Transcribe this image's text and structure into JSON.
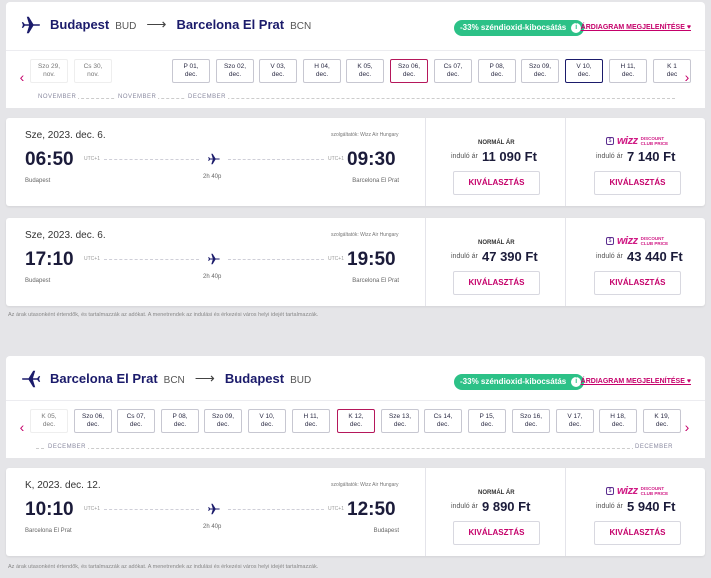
{
  "outbound": {
    "from_city": "Budapest",
    "from_code": "BUD",
    "to_city": "Barcelona El Prat",
    "to_code": "BCN",
    "arrow": "⟶",
    "co2": "-33% széndioxid-kibocsátás",
    "co2_info": "i",
    "price_chart": "ÁRDIAGRAM MEGJELENÍTÉSE ♥",
    "dates": [
      {
        "l1": "Szo 29,",
        "l2": "nov."
      },
      {
        "l1": "Cs 30,",
        "l2": "nov."
      },
      {
        "l1": "P 01,",
        "l2": "dec."
      },
      {
        "l1": "Szo 02,",
        "l2": "dec."
      },
      {
        "l1": "V 03,",
        "l2": "dec."
      },
      {
        "l1": "H 04,",
        "l2": "dec."
      },
      {
        "l1": "K 05,",
        "l2": "dec."
      },
      {
        "l1": "Szo 06,",
        "l2": "dec."
      },
      {
        "l1": "Cs 07,",
        "l2": "dec."
      },
      {
        "l1": "P 08,",
        "l2": "dec."
      },
      {
        "l1": "Szo 09,",
        "l2": "dec."
      },
      {
        "l1": "V 10,",
        "l2": "dec."
      },
      {
        "l1": "H 11,",
        "l2": "dec."
      },
      {
        "l1": "K 1",
        "l2": "dec"
      }
    ],
    "months": [
      "NOVEMBER",
      "NOVEMBER",
      "DECEMBER"
    ],
    "flights": [
      {
        "date": "Sze, 2023. dec. 6.",
        "operated": "szolgáltatók: Wizz Air Hungary",
        "dep": "06:50",
        "arr": "09:30",
        "utc_dep": "UTC+1",
        "utc_arr": "UTC+1",
        "duration": "2h 40p",
        "dep_city": "Budapest",
        "arr_city": "Barcelona El Prat",
        "normal_title": "NORMÁL ÁR",
        "from_label": "induló ár",
        "normal_price": "11 090 Ft",
        "wdc_price": "7 140 Ft",
        "select": "KIVÁLASZTÁS"
      },
      {
        "date": "Sze, 2023. dec. 6.",
        "operated": "szolgáltatók: Wizz Air Hungary",
        "dep": "17:10",
        "arr": "19:50",
        "utc_dep": "UTC+1",
        "utc_arr": "UTC+1",
        "duration": "2h 40p",
        "dep_city": "Budapest",
        "arr_city": "Barcelona El Prat",
        "normal_title": "NORMÁL ÁR",
        "from_label": "induló ár",
        "normal_price": "47 390 Ft",
        "wdc_price": "43 440 Ft",
        "select": "KIVÁLASZTÁS"
      }
    ]
  },
  "return": {
    "from_city": "Barcelona El Prat",
    "from_code": "BCN",
    "to_city": "Budapest",
    "to_code": "BUD",
    "arrow": "⟶",
    "co2": "-33% széndioxid-kibocsátás",
    "co2_info": "i",
    "price_chart": "ÁRDIAGRAM MEGJELENÍTÉSE ♥",
    "dates": [
      {
        "l1": "K 05,",
        "l2": "dec."
      },
      {
        "l1": "Szo 06,",
        "l2": "dec."
      },
      {
        "l1": "Cs 07,",
        "l2": "dec."
      },
      {
        "l1": "P 08,",
        "l2": "dec."
      },
      {
        "l1": "Szo 09,",
        "l2": "dec."
      },
      {
        "l1": "V 10,",
        "l2": "dec."
      },
      {
        "l1": "H 11,",
        "l2": "dec."
      },
      {
        "l1": "K 12,",
        "l2": "dec."
      },
      {
        "l1": "Sze 13,",
        "l2": "dec."
      },
      {
        "l1": "Cs 14,",
        "l2": "dec."
      },
      {
        "l1": "P 15,",
        "l2": "dec."
      },
      {
        "l1": "Szo 16,",
        "l2": "dec."
      },
      {
        "l1": "V 17,",
        "l2": "dec."
      },
      {
        "l1": "H 18,",
        "l2": "dec."
      },
      {
        "l1": "K 19,",
        "l2": "dec."
      }
    ],
    "months": [
      "DECEMBER",
      "DECEMBER"
    ],
    "flights": [
      {
        "date": "K, 2023. dec. 12.",
        "operated": "szolgáltatók: Wizz Air Hungary",
        "dep": "10:10",
        "arr": "12:50",
        "utc_dep": "UTC+1",
        "utc_arr": "UTC+1",
        "duration": "2h 40p",
        "dep_city": "Barcelona El Prat",
        "arr_city": "Budapest",
        "normal_title": "NORMÁL ÁR",
        "from_label": "induló ár",
        "normal_price": "9 890 Ft",
        "wdc_price": "5 940 Ft",
        "select": "KIVÁLASZTÁS"
      }
    ]
  },
  "wdc": {
    "badge": "$",
    "logo": "wizz",
    "line1": "DISCOUNT",
    "line2": "CLUB PRICE"
  },
  "note": "Az árak utasonként értendők, és tartalmazzák az adókat. A menetrendek az indulási és érkezési város helyi idejét tartalmazzák.",
  "nav": {
    "prev": "‹",
    "next": "›"
  },
  "colors": {
    "brand": "#1b1b6b",
    "accent": "#c5006a",
    "co2": "#2cc187"
  }
}
